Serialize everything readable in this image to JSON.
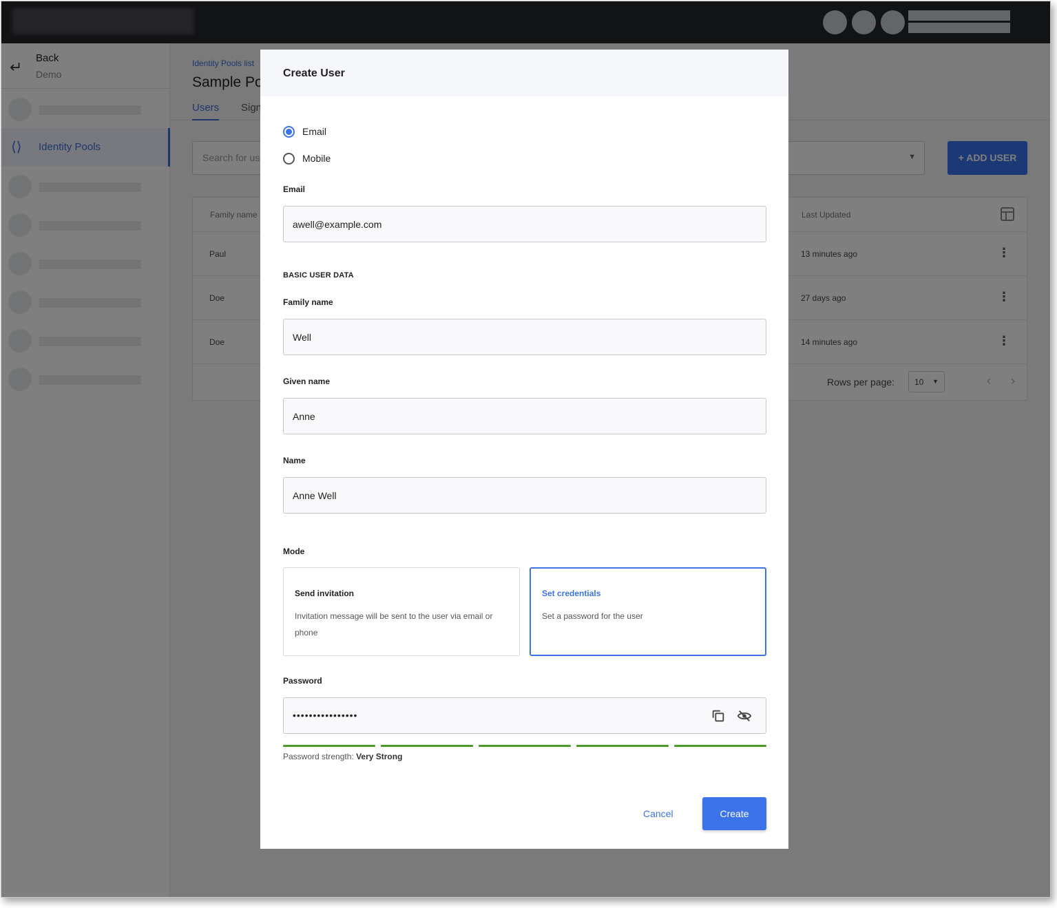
{
  "sidebar": {
    "back_label": "Back",
    "back_sub": "Demo",
    "active_item": "Identity Pools"
  },
  "main": {
    "breadcrumb": "Identity Pools list",
    "title": "Sample Pool",
    "tabs": [
      "Users",
      "Sign"
    ],
    "search_placeholder": "Search for users",
    "add_user_label": "+ ADD USER",
    "table": {
      "headers": [
        "Family name",
        "Last Updated"
      ],
      "rows": [
        {
          "family": "Paul",
          "updated": "13 minutes ago"
        },
        {
          "family": "Doe",
          "updated": "27 days ago"
        },
        {
          "family": "Doe",
          "updated": "14 minutes ago"
        }
      ],
      "rows_per_page_label": "Rows per page:",
      "rows_per_page": "10"
    }
  },
  "modal": {
    "title": "Create User",
    "identifier_options": [
      {
        "label": "Email",
        "checked": true
      },
      {
        "label": "Mobile",
        "checked": false
      }
    ],
    "email_label": "Email",
    "email_value": "awell@example.com",
    "section_title": "BASIC USER DATA",
    "family_name_label": "Family name",
    "family_name_value": "Well",
    "given_name_label": "Given name",
    "given_name_value": "Anne",
    "name_label": "Name",
    "name_value": "Anne Well",
    "mode_label": "Mode",
    "modes": [
      {
        "title": "Send invitation",
        "desc": "Invitation message will be sent to the user via email or phone",
        "selected": false
      },
      {
        "title": "Set credentials",
        "desc": "Set a password for the user",
        "selected": true
      }
    ],
    "password_label": "Password",
    "password_value": "••••••••••••••••",
    "strength_prefix": "Password strength:",
    "strength_value": "Very Strong",
    "strength_segments_filled": 5,
    "strength_segments_total": 5,
    "cancel_label": "Cancel",
    "create_label": "Create",
    "accent_color": "#3b73ea",
    "strength_color": "#4a9a2a"
  }
}
